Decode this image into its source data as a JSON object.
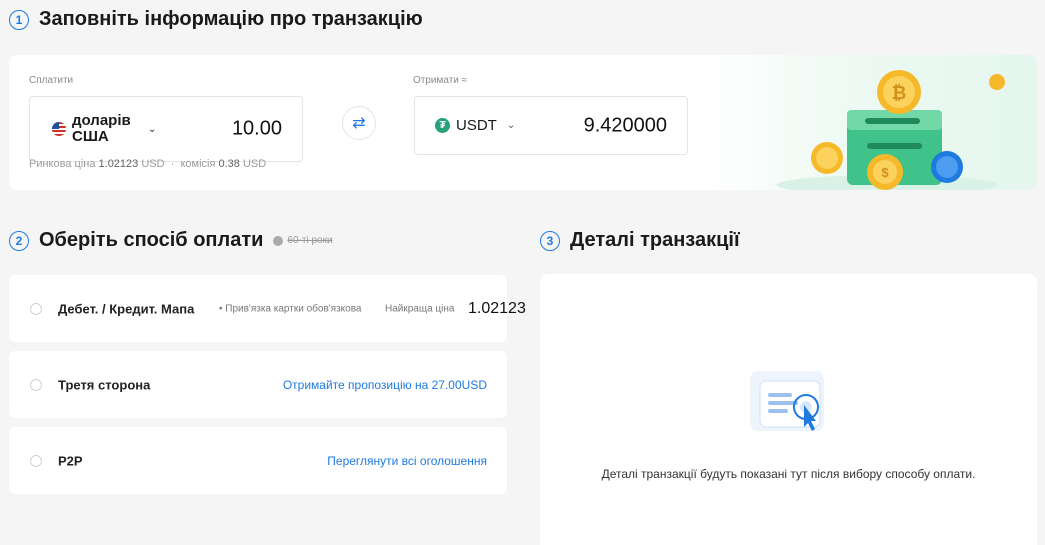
{
  "steps": {
    "one": {
      "num": "1",
      "title": "Заповніть інформацію про транзакцію"
    },
    "two": {
      "num": "2",
      "title": "Оберіть спосіб оплати",
      "badge": "60-ті роки"
    },
    "three": {
      "num": "3",
      "title": "Деталі транзакції"
    }
  },
  "pay": {
    "label": "Сплатити",
    "currency": "доларів США",
    "currency_icon": "us-flag-icon",
    "amount": "10.00",
    "market_label": "Ринкова ціна",
    "market_value": "1.02123",
    "market_unit": "USD",
    "fee_label": "комісія",
    "fee_value": "0.38",
    "fee_unit": "USD"
  },
  "receive": {
    "label": "Отримати ≈",
    "currency": "USDT",
    "currency_icon": "tether-icon",
    "amount": "9.420000"
  },
  "swap_icon": "⇄",
  "methods": [
    {
      "title": "Дебет. / Кредит. Мапа",
      "note": "• Прив'язка картки обов'язкова",
      "best_label": "Найкраща ціна",
      "best_value": "1.02123"
    },
    {
      "title": "Третя сторона",
      "link": "Отримайте пропозицію на 27.00USD"
    },
    {
      "title": "P2P",
      "link": "Переглянути всі оголошення"
    }
  ],
  "details": {
    "message": "Деталі транзакції будуть показані тут після вибору способу оплати."
  },
  "colors": {
    "accent": "#1f7ae0",
    "tether": "#26a17b"
  }
}
